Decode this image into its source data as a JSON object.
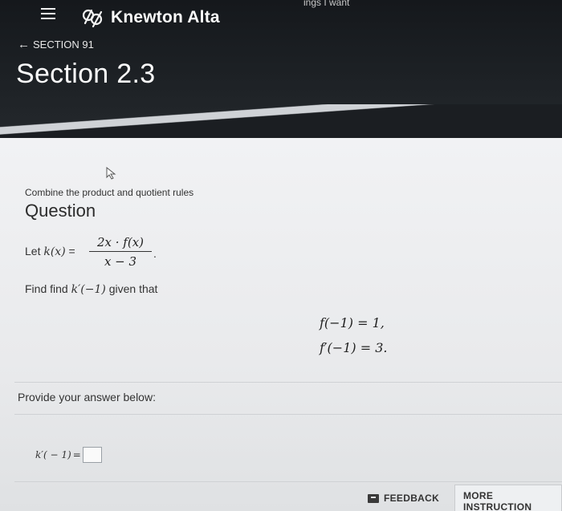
{
  "window": {
    "top_partial_text": "ings I want"
  },
  "header": {
    "brand": "Knewton Alta",
    "back_link": "SECTION 91",
    "section_title": "Section 2.3"
  },
  "question": {
    "subtitle": "Combine the product and quotient rules",
    "label": "Question",
    "let_prefix": "Let ",
    "let_lhs": "k(x)",
    "let_eq": " = ",
    "numerator": "2x · f(x)",
    "denominator": "x − 3",
    "period": ".",
    "find_prefix": "Find find ",
    "find_expr": "k′(−1)",
    "find_suffix": " given that",
    "given_1": "f(−1) = 1,",
    "given_2": "f′(−1) = 3."
  },
  "answer": {
    "prompt": "Provide your answer below:",
    "lhs": "k′( − 1)",
    "eq": "="
  },
  "footer": {
    "feedback_label": "FEEDBACK",
    "more_instruction_label": "MORE INSTRUCTION"
  },
  "icons": {
    "menu": "hamburger-menu-icon",
    "logo": "knewton-logo-icon",
    "back": "arrow-left-icon",
    "feedback": "feedback-icon",
    "cursor": "mouse-cursor-icon"
  },
  "colors": {
    "header_bg": "#1a1d21",
    "content_bg": "#eeeff1",
    "text": "#333333"
  }
}
